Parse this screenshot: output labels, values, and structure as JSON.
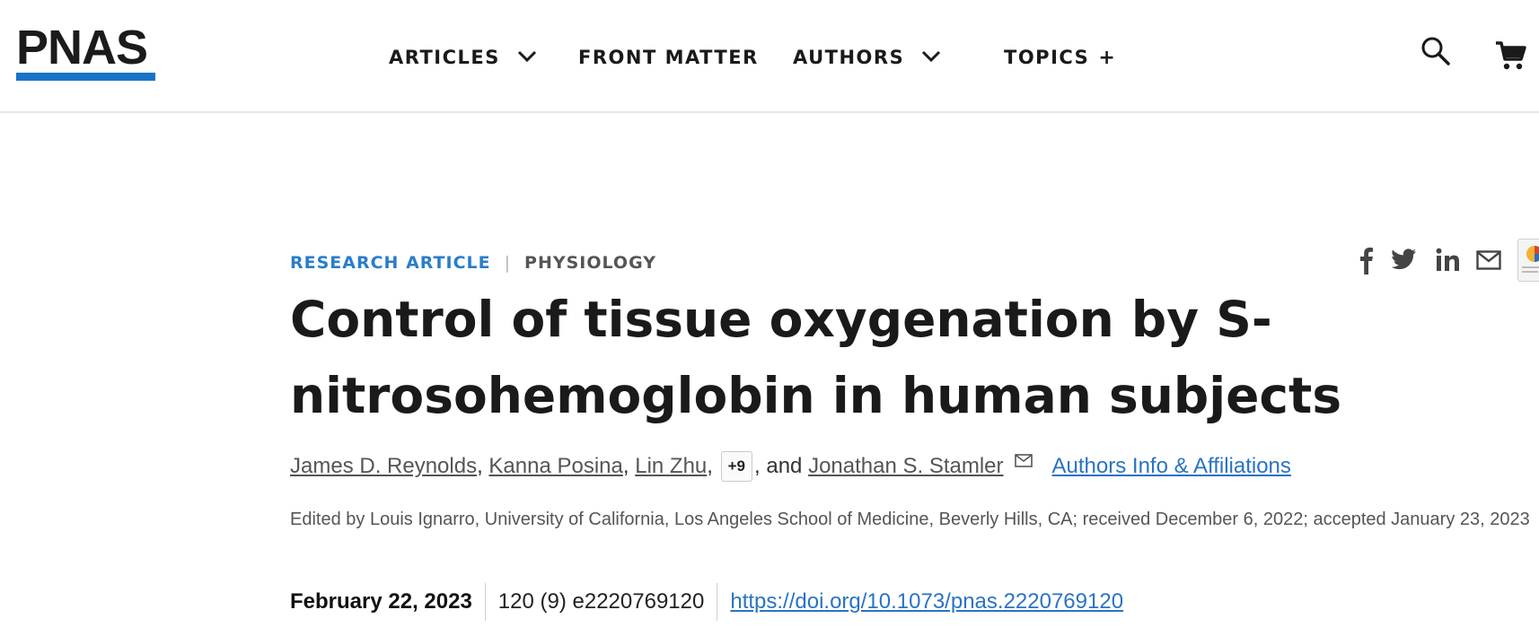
{
  "header": {
    "logo": "PNAS",
    "nav": {
      "articles": "ARTICLES",
      "front_matter": "FRONT MATTER",
      "authors": "AUTHORS",
      "topics": "TOPICS",
      "topics_suffix": "+"
    },
    "icons": [
      "search-icon",
      "cart-icon"
    ],
    "logo_color": "#1873c7"
  },
  "article": {
    "type": "RESEARCH ARTICLE",
    "separator": "|",
    "subject": "PHYSIOLOGY",
    "title": "Control of tissue oxygenation by S-nitrosohemoglobin in human subjects",
    "authors": {
      "a1": "James D. Reynolds",
      "a2": "Kanna Posina",
      "a3": "Lin Zhu",
      "more": "+9",
      "conj": ", and ",
      "last": "Jonathan S. Stamler",
      "affiliations_link": "Authors Info & Affiliations"
    },
    "edited_by": "Edited by Louis Ignarro, University of California, Los Angeles School of Medicine, Beverly Hills, CA; received December 6, 2022; accepted January 23, 2023",
    "date": "February 22, 2023",
    "citation": "120 (9) e2220769120",
    "doi": "https://doi.org/10.1073/pnas.2220769120"
  },
  "share_icons": [
    "facebook-icon",
    "twitter-icon",
    "linkedin-icon",
    "email-icon"
  ],
  "colors": {
    "accent": "#2a7dc9",
    "link": "#2a73c4"
  }
}
